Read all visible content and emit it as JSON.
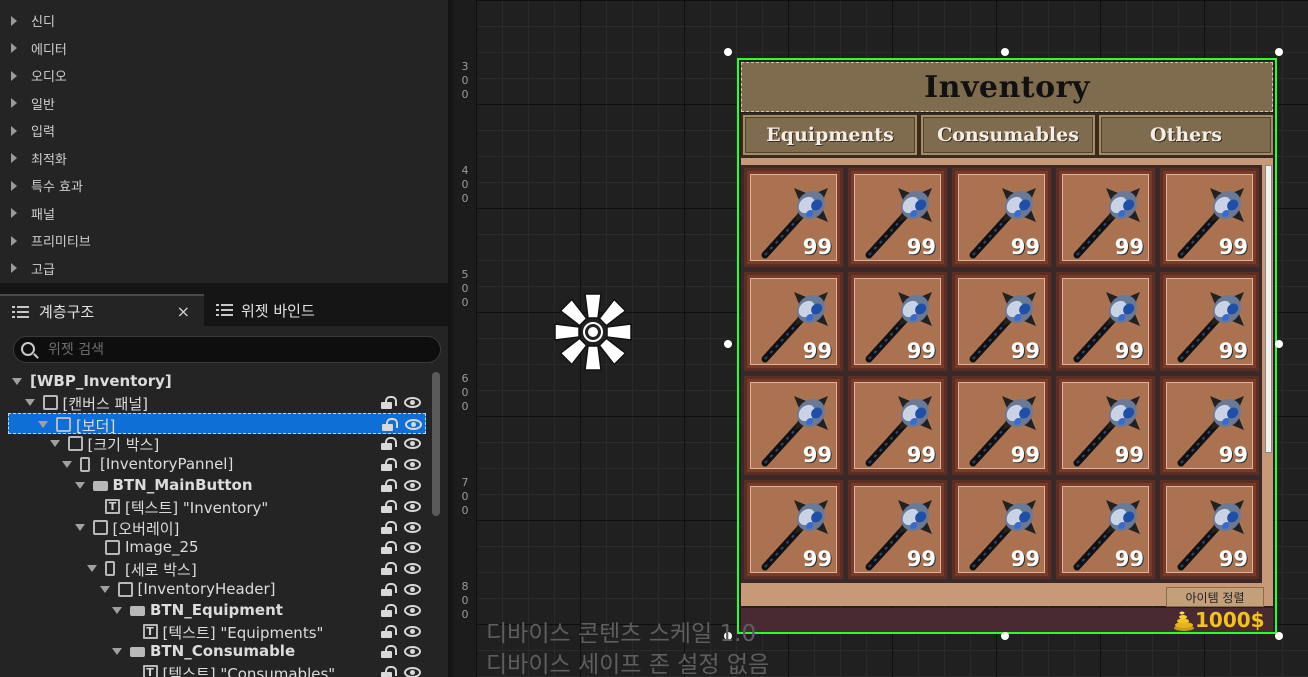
{
  "palette": {
    "categories": [
      "신디",
      "에디터",
      "오디오",
      "일반",
      "입력",
      "최적화",
      "특수 효과",
      "패널",
      "프리미티브",
      "고급"
    ]
  },
  "tabs": {
    "hierarchy_label": "계층구조",
    "close_glyph": "×",
    "widget_bind_label": "위젯 바인드"
  },
  "search": {
    "placeholder": "위젯 검색"
  },
  "tree": [
    {
      "label": "[WBP_Inventory]",
      "bold": true,
      "icon": "none"
    },
    {
      "label": "[캔버스 패널]",
      "bold": false,
      "icon": "canvas-panel-icon"
    },
    {
      "label": "[보더]",
      "bold": false,
      "icon": "border-icon",
      "selected": true
    },
    {
      "label": "[크기 박스]",
      "bold": false,
      "icon": "size-box-icon"
    },
    {
      "label": "[InventoryPannel]",
      "bold": false,
      "icon": "vertical-box-icon"
    },
    {
      "label": "BTN_MainButton",
      "bold": true,
      "icon": "button-icon"
    },
    {
      "label": "[텍스트] \"Inventory\"",
      "bold": false,
      "icon": "text-icon"
    },
    {
      "label": "[오버레이]",
      "bold": false,
      "icon": "overlay-icon"
    },
    {
      "label": "Image_25",
      "bold": false,
      "icon": "image-icon"
    },
    {
      "label": "[세로 박스]",
      "bold": false,
      "icon": "vertical-box-icon"
    },
    {
      "label": "[InventoryHeader]",
      "bold": false,
      "icon": "horizontal-box-icon"
    },
    {
      "label": "BTN_Equipment",
      "bold": true,
      "icon": "button-icon"
    },
    {
      "label": "[텍스트] \"Equipments\"",
      "bold": false,
      "icon": "text-icon"
    },
    {
      "label": "BTN_Consumable",
      "bold": true,
      "icon": "button-icon"
    },
    {
      "label": "[텍스트] \"Consumables\"",
      "bold": false,
      "icon": "text-icon"
    }
  ],
  "ruler": [
    "3\n0\n0",
    "4\n0\n0",
    "5\n0\n0",
    "6\n0\n0",
    "7\n0\n0",
    "8\n0\n0"
  ],
  "canvas": {
    "dpi_scale_text": "디바이스 콘텐츠 스케일 1.0",
    "safe_zone_text": "디바이스 세이프 존 설정 없음"
  },
  "inventory": {
    "title": "Inventory",
    "tabs": [
      "Equipments",
      "Consumables",
      "Others"
    ],
    "item_icon": "mace-icon",
    "item_count": "99",
    "sort_button": "아이템 정렬",
    "money": "1000$",
    "colors": {
      "header": "#7f6b4d",
      "slot": "#ab7251",
      "money_bar": "#4a2a32",
      "money_text": "#f2c21e",
      "selection_outline": "#2bff2b",
      "tree_selected": "#0e70d6"
    }
  }
}
